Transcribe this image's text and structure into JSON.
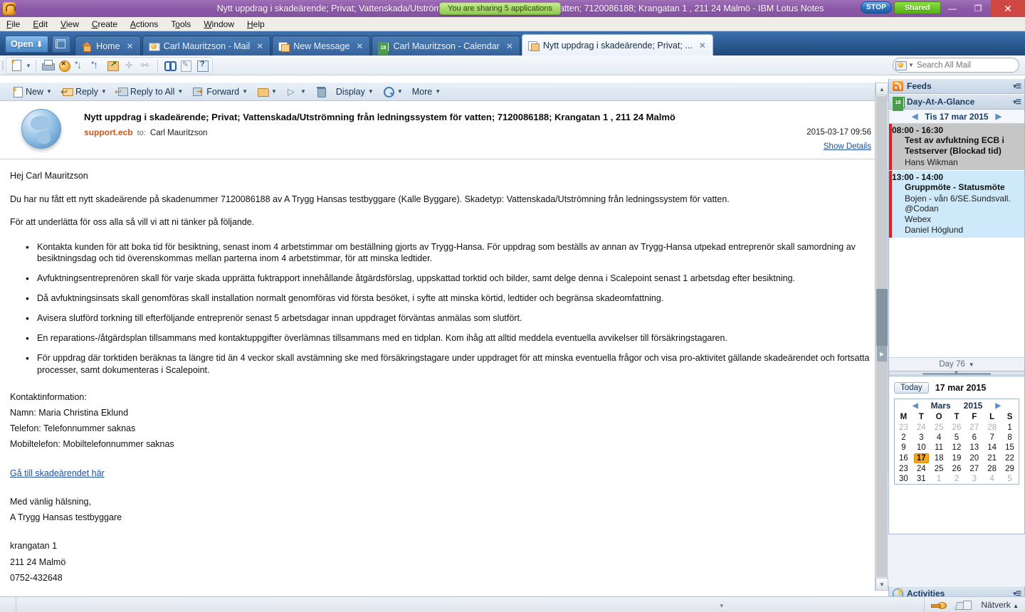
{
  "window": {
    "title": "Nytt uppdrag i skadeärende; Privat; Vattenskada/Utströmning från ledningssystem för vatten; 7120086188; Krangatan 1 , 211 24 Malmö - IBM Lotus Notes",
    "sharing_notice": "You are sharing 5 applications",
    "stop_label": "STOP",
    "shared_label": "Shared",
    "minimize": "—",
    "restore": "❐",
    "close": "✕"
  },
  "menubar": {
    "items": [
      {
        "label": "File"
      },
      {
        "label": "Edit"
      },
      {
        "label": "View"
      },
      {
        "label": "Create"
      },
      {
        "label": "Actions"
      },
      {
        "label": "Tools"
      },
      {
        "label": "Window"
      },
      {
        "label": "Help"
      }
    ]
  },
  "tabbar": {
    "open_label": "Open",
    "tabs": [
      {
        "label": "Home",
        "icon": "home-icon",
        "active": false
      },
      {
        "label": "Carl Mauritzson - Mail",
        "icon": "mail-icon",
        "active": false
      },
      {
        "label": "New Message",
        "icon": "new-message-icon",
        "active": false
      },
      {
        "label": "Carl Mauritzson - Calendar",
        "icon": "calendar-icon",
        "active": false
      },
      {
        "label": "Nytt uppdrag i skadeärende; Privat; ...",
        "icon": "document-icon",
        "active": true
      }
    ],
    "close_glyph": "✕"
  },
  "search": {
    "placeholder": "Search All Mail",
    "value": ""
  },
  "toolbar_icons": [
    {
      "name": "new-document-icon"
    },
    {
      "name": "print-icon"
    },
    {
      "name": "delete-icon"
    },
    {
      "name": "move-down-icon"
    },
    {
      "name": "move-up-icon"
    },
    {
      "name": "folder-move-icon"
    },
    {
      "name": "add-icon"
    },
    {
      "name": "link-icon"
    },
    {
      "name": "search-binoculars-icon"
    },
    {
      "name": "edit-icon"
    },
    {
      "name": "help-icon"
    }
  ],
  "actionbar": {
    "items": [
      {
        "label": "New",
        "icon": "new-icon",
        "caret": true
      },
      {
        "label": "Reply",
        "icon": "reply-icon",
        "caret": true
      },
      {
        "label": "Reply to All",
        "icon": "reply-all-icon",
        "caret": true
      },
      {
        "label": "Forward",
        "icon": "forward-icon",
        "caret": true
      },
      {
        "label": "",
        "icon": "folder-icon",
        "caret": true
      },
      {
        "label": "",
        "icon": "flag-icon",
        "caret": true
      },
      {
        "label": "",
        "icon": "trash-icon",
        "caret": false
      },
      {
        "label": "Display",
        "icon": "",
        "caret": true
      },
      {
        "label": "",
        "icon": "search-icon",
        "caret": true
      },
      {
        "label": "More",
        "icon": "",
        "caret": true
      }
    ],
    "caret_glyph": "▼"
  },
  "message": {
    "subject": "Nytt uppdrag i skadeärende; Privat; Vattenskada/Utströmning från ledningssystem för vatten; 7120086188; Krangatan 1 , 211 24 Malmö",
    "from": "support.ecb",
    "to_label": "to:",
    "to": "Carl Mauritzson",
    "date": "2015-03-17 09:56",
    "show_details": "Show Details",
    "greeting": "Hej Carl Mauritzson",
    "intro": "Du har nu fått ett nytt skadeärende på skadenummer 7120086188 av A Trygg Hansas testbyggare (Kalle Byggare). Skadetyp: Vattenskada/Utströmning från ledningssystem för vatten.",
    "lead": "För att underlätta för oss alla så vill vi att ni tänker på följande.",
    "bullets": [
      "Kontakta kunden för att boka tid för besiktning, senast inom 4 arbetstimmar om beställning gjorts av Trygg-Hansa. För uppdrag som beställs av annan av Trygg-Hansa utpekad entreprenör skall samordning av besiktningsdag och tid överenskommas mellan parterna inom 4 arbetstimmar, för att minska ledtider.",
      "Avfuktningsentreprenören skall för varje skada upprätta fuktrapport innehållande åtgärdsförslag, uppskattad torktid och bilder, samt delge denna i Scalepoint senast 1 arbetsdag efter besiktning.",
      "Då avfuktningsinsats skall genomföras skall installation normalt genomföras vid första besöket, i syfte att minska körtid, ledtider och begränsa skadeomfattning.",
      "Avisera slutförd torkning till efterföljande entreprenör senast 5 arbetsdagar innan uppdraget förväntas anmälas som slutfört.",
      "En reparations-/åtgärdsplan tillsammans med kontaktuppgifter överlämnas tillsammans med en tidplan. Kom ihåg att alltid meddela eventuella avvikelser till försäkringstagaren.",
      "För uppdrag där torktiden beräknas ta längre tid än 4 veckor skall avstämning ske med försäkringstagare under uppdraget för att minska eventuella frågor och visa pro-aktivitet gällande skadeärendet och fortsatta processer, samt dokumenteras i Scalepoint."
    ],
    "contact_heading": "Kontaktinformation:",
    "contact_name": "Namn: Maria Christina Eklund",
    "contact_phone": "Telefon: Telefonnummer saknas",
    "contact_mobile": "Mobiltelefon: Mobiltelefonnummer saknas",
    "case_link": "Gå till skadeärendet här",
    "signoff": "Med vänlig hälsning,",
    "sender_name": "A Trygg Hansas testbyggare",
    "address_street": "krangatan 1",
    "address_city": "211 24 Malmö",
    "address_phone": "0752-432648"
  },
  "sidebar": {
    "feeds": {
      "title": "Feeds",
      "icon": "rss-icon",
      "menu_glyph": "▾☰"
    },
    "glance": {
      "title": "Day-At-A-Glance",
      "icon": "calendar-icon",
      "menu_glyph": "▾☰",
      "prev_glyph": "◀",
      "next_glyph": "▶",
      "date_label": "Tis 17 mar 2015",
      "events": [
        {
          "time": "08:00 - 16:30",
          "title_lines": [
            "Test av avfuktning ECB i",
            "Testserver (Blockad tid)"
          ],
          "detail_lines": [
            "Hans Wikman"
          ],
          "style": "gray"
        },
        {
          "time": "13:00 - 14:00",
          "title_lines": [
            "Gruppmöte - Statusmöte"
          ],
          "detail_lines": [
            "Bojen - vån 6/SE.Sundsvall.",
            "@Codan",
            "Webex",
            "Daniel Höglund"
          ],
          "style": "blue"
        }
      ],
      "day_counter": "Day 76",
      "day_counter_caret": "▼"
    },
    "minicalendar": {
      "today_label": "Today",
      "selected_date_label": "17 mar 2015",
      "prev_glyph": "◀",
      "next_glyph": "▶",
      "month_label": "Mars",
      "year_label": "2015",
      "weekday_headers": [
        "M",
        "T",
        "O",
        "T",
        "F",
        "L",
        "S"
      ],
      "weeks": [
        [
          {
            "d": "23",
            "dim": true
          },
          {
            "d": "24",
            "dim": true
          },
          {
            "d": "25",
            "dim": true
          },
          {
            "d": "26",
            "dim": true
          },
          {
            "d": "27",
            "dim": true
          },
          {
            "d": "28",
            "dim": true
          },
          {
            "d": "1",
            "dim": false
          }
        ],
        [
          {
            "d": "2",
            "dim": false
          },
          {
            "d": "3",
            "dim": false
          },
          {
            "d": "4",
            "dim": false
          },
          {
            "d": "5",
            "dim": false
          },
          {
            "d": "6",
            "dim": false
          },
          {
            "d": "7",
            "dim": false
          },
          {
            "d": "8",
            "dim": false
          }
        ],
        [
          {
            "d": "9",
            "dim": false
          },
          {
            "d": "10",
            "dim": false
          },
          {
            "d": "11",
            "dim": false
          },
          {
            "d": "12",
            "dim": false
          },
          {
            "d": "13",
            "dim": false
          },
          {
            "d": "14",
            "dim": false
          },
          {
            "d": "15",
            "dim": false
          }
        ],
        [
          {
            "d": "16",
            "dim": false
          },
          {
            "d": "17",
            "dim": false,
            "selected": true
          },
          {
            "d": "18",
            "dim": false
          },
          {
            "d": "19",
            "dim": false
          },
          {
            "d": "20",
            "dim": false
          },
          {
            "d": "21",
            "dim": false
          },
          {
            "d": "22",
            "dim": false
          }
        ],
        [
          {
            "d": "23",
            "dim": false
          },
          {
            "d": "24",
            "dim": false
          },
          {
            "d": "25",
            "dim": false
          },
          {
            "d": "26",
            "dim": false
          },
          {
            "d": "27",
            "dim": false
          },
          {
            "d": "28",
            "dim": false
          },
          {
            "d": "29",
            "dim": false
          }
        ],
        [
          {
            "d": "30",
            "dim": false
          },
          {
            "d": "31",
            "dim": false
          },
          {
            "d": "1",
            "dim": true
          },
          {
            "d": "2",
            "dim": true
          },
          {
            "d": "3",
            "dim": true
          },
          {
            "d": "4",
            "dim": true
          },
          {
            "d": "5",
            "dim": true
          }
        ]
      ]
    },
    "activities": {
      "title": "Activities",
      "icon": "activities-icon",
      "menu_glyph": "▾☰"
    }
  },
  "statusbar": {
    "network_label": "Nätverk",
    "network_caret": "▲",
    "key_icon": "key-icon",
    "network_icon": "network-icon",
    "scroll_caret": "▾"
  },
  "colors": {
    "title_bar": "#8e5ba8",
    "tab_bar": "#2e5c96",
    "accent_orange": "#c8571a",
    "link_blue": "#1e4fa0",
    "event_red_bar": "#e02020",
    "event_blue": "#cde9fa",
    "event_gray": "#c6c6c6",
    "today_highlight": "#f5a623",
    "shared_green": "#6ec62a"
  }
}
